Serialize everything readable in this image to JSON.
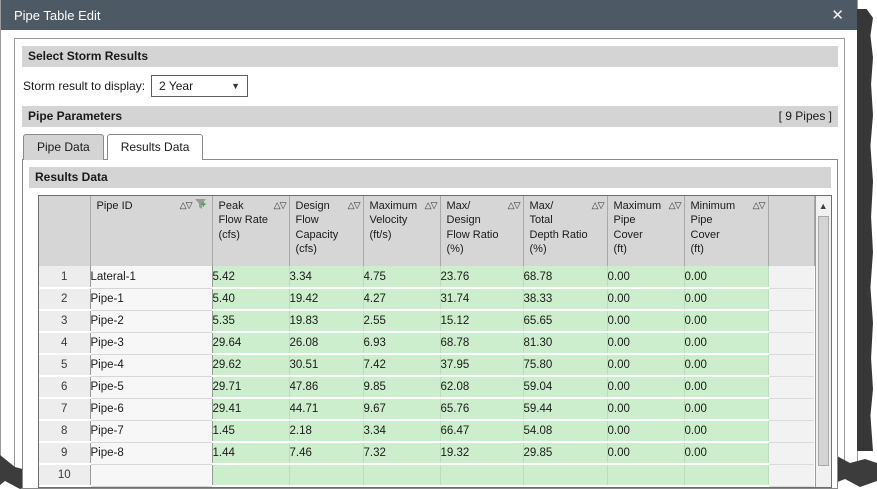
{
  "window": {
    "title": "Pipe Table Edit",
    "close_glyph": "✕"
  },
  "colors": {
    "titlebar": "#4e5966",
    "section_band": "#d4d4d4",
    "result_cell_green": "#cdeecd",
    "header_gray": "#d6d6d6",
    "shadow": "#373737"
  },
  "storm": {
    "section_title": "Select Storm Results",
    "label": "Storm result to display:",
    "selected_option": "2 Year",
    "dropdown_glyph": "▼"
  },
  "pipe_parameters": {
    "section_title": "Pipe Parameters",
    "count_badge": "[ 9 Pipes ]"
  },
  "tabs": [
    {
      "label": "Pipe Data"
    },
    {
      "label": "Results Data"
    }
  ],
  "results_section_title": "Results Data",
  "grid": {
    "sort_glyph": "△▽",
    "scroll_up_glyph": "▲",
    "headers": [
      "Pipe ID",
      "Peak\nFlow Rate\n(cfs)",
      "Design\nFlow\nCapacity\n(cfs)",
      "Maximum\nVelocity\n(ft/s)",
      "Max/\nDesign\nFlow Ratio\n(%)",
      "Max/\nTotal\nDepth Ratio\n(%)",
      "Maximum\nPipe\nCover\n(ft)",
      "Minimum\nPipe\nCover\n(ft)"
    ],
    "rows": [
      {
        "num": "1",
        "id": "Lateral-1",
        "v": [
          "5.42",
          "3.34",
          "4.75",
          "23.76",
          "68.78",
          "0.00",
          "0.00"
        ]
      },
      {
        "num": "2",
        "id": "Pipe-1",
        "v": [
          "5.40",
          "19.42",
          "4.27",
          "31.74",
          "38.33",
          "0.00",
          "0.00"
        ]
      },
      {
        "num": "3",
        "id": "Pipe-2",
        "v": [
          "5.35",
          "19.83",
          "2.55",
          "15.12",
          "65.65",
          "0.00",
          "0.00"
        ]
      },
      {
        "num": "4",
        "id": "Pipe-3",
        "v": [
          "29.64",
          "26.08",
          "6.93",
          "68.78",
          "81.30",
          "0.00",
          "0.00"
        ]
      },
      {
        "num": "5",
        "id": "Pipe-4",
        "v": [
          "29.62",
          "30.51",
          "7.42",
          "37.95",
          "75.80",
          "0.00",
          "0.00"
        ]
      },
      {
        "num": "6",
        "id": "Pipe-5",
        "v": [
          "29.71",
          "47.86",
          "9.85",
          "62.08",
          "59.04",
          "0.00",
          "0.00"
        ]
      },
      {
        "num": "7",
        "id": "Pipe-6",
        "v": [
          "29.41",
          "44.71",
          "9.67",
          "65.76",
          "59.44",
          "0.00",
          "0.00"
        ]
      },
      {
        "num": "8",
        "id": "Pipe-7",
        "v": [
          "1.45",
          "2.18",
          "3.34",
          "66.47",
          "54.08",
          "0.00",
          "0.00"
        ]
      },
      {
        "num": "9",
        "id": "Pipe-8",
        "v": [
          "1.44",
          "7.46",
          "7.32",
          "19.32",
          "29.85",
          "0.00",
          "0.00"
        ]
      },
      {
        "num": "10",
        "id": "",
        "v": [
          "",
          "",
          "",
          "",
          "",
          "",
          ""
        ]
      }
    ]
  }
}
